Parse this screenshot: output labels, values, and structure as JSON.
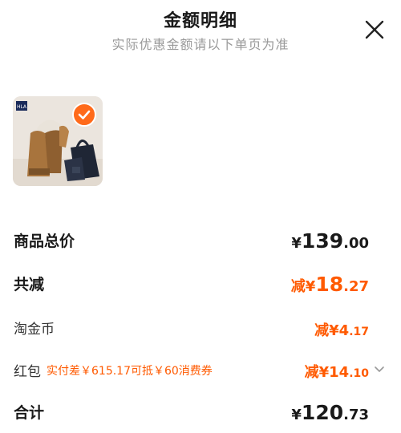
{
  "header": {
    "title": "金额明细",
    "subtitle": "实际优惠金额请以下单页为准"
  },
  "product": {
    "badge_text": "HLA",
    "selected": true
  },
  "rows": {
    "total_goods": {
      "label": "商品总价",
      "symbol": "¥",
      "int": "139",
      "dec": ".00"
    },
    "total_discount": {
      "label": "共减",
      "prefix": "减",
      "symbol": "¥",
      "int": "18",
      "dec": ".27"
    },
    "coins": {
      "label": "淘金币",
      "prefix": "减",
      "symbol": "¥",
      "int": "4",
      "dec": ".17"
    },
    "red_packet": {
      "label": "红包",
      "note": "实付差￥615.17可抵￥60消费券",
      "prefix": "减",
      "symbol": "¥",
      "int": "14",
      "dec": ".10"
    },
    "sum": {
      "label": "合计",
      "symbol": "¥",
      "int": "120",
      "dec": ".73"
    }
  },
  "colors": {
    "accent": "#ff5a00",
    "check": "#ff6a1a"
  },
  "icons": {
    "close": "close-icon",
    "check": "check-icon",
    "expand": "chevron-down-icon"
  }
}
